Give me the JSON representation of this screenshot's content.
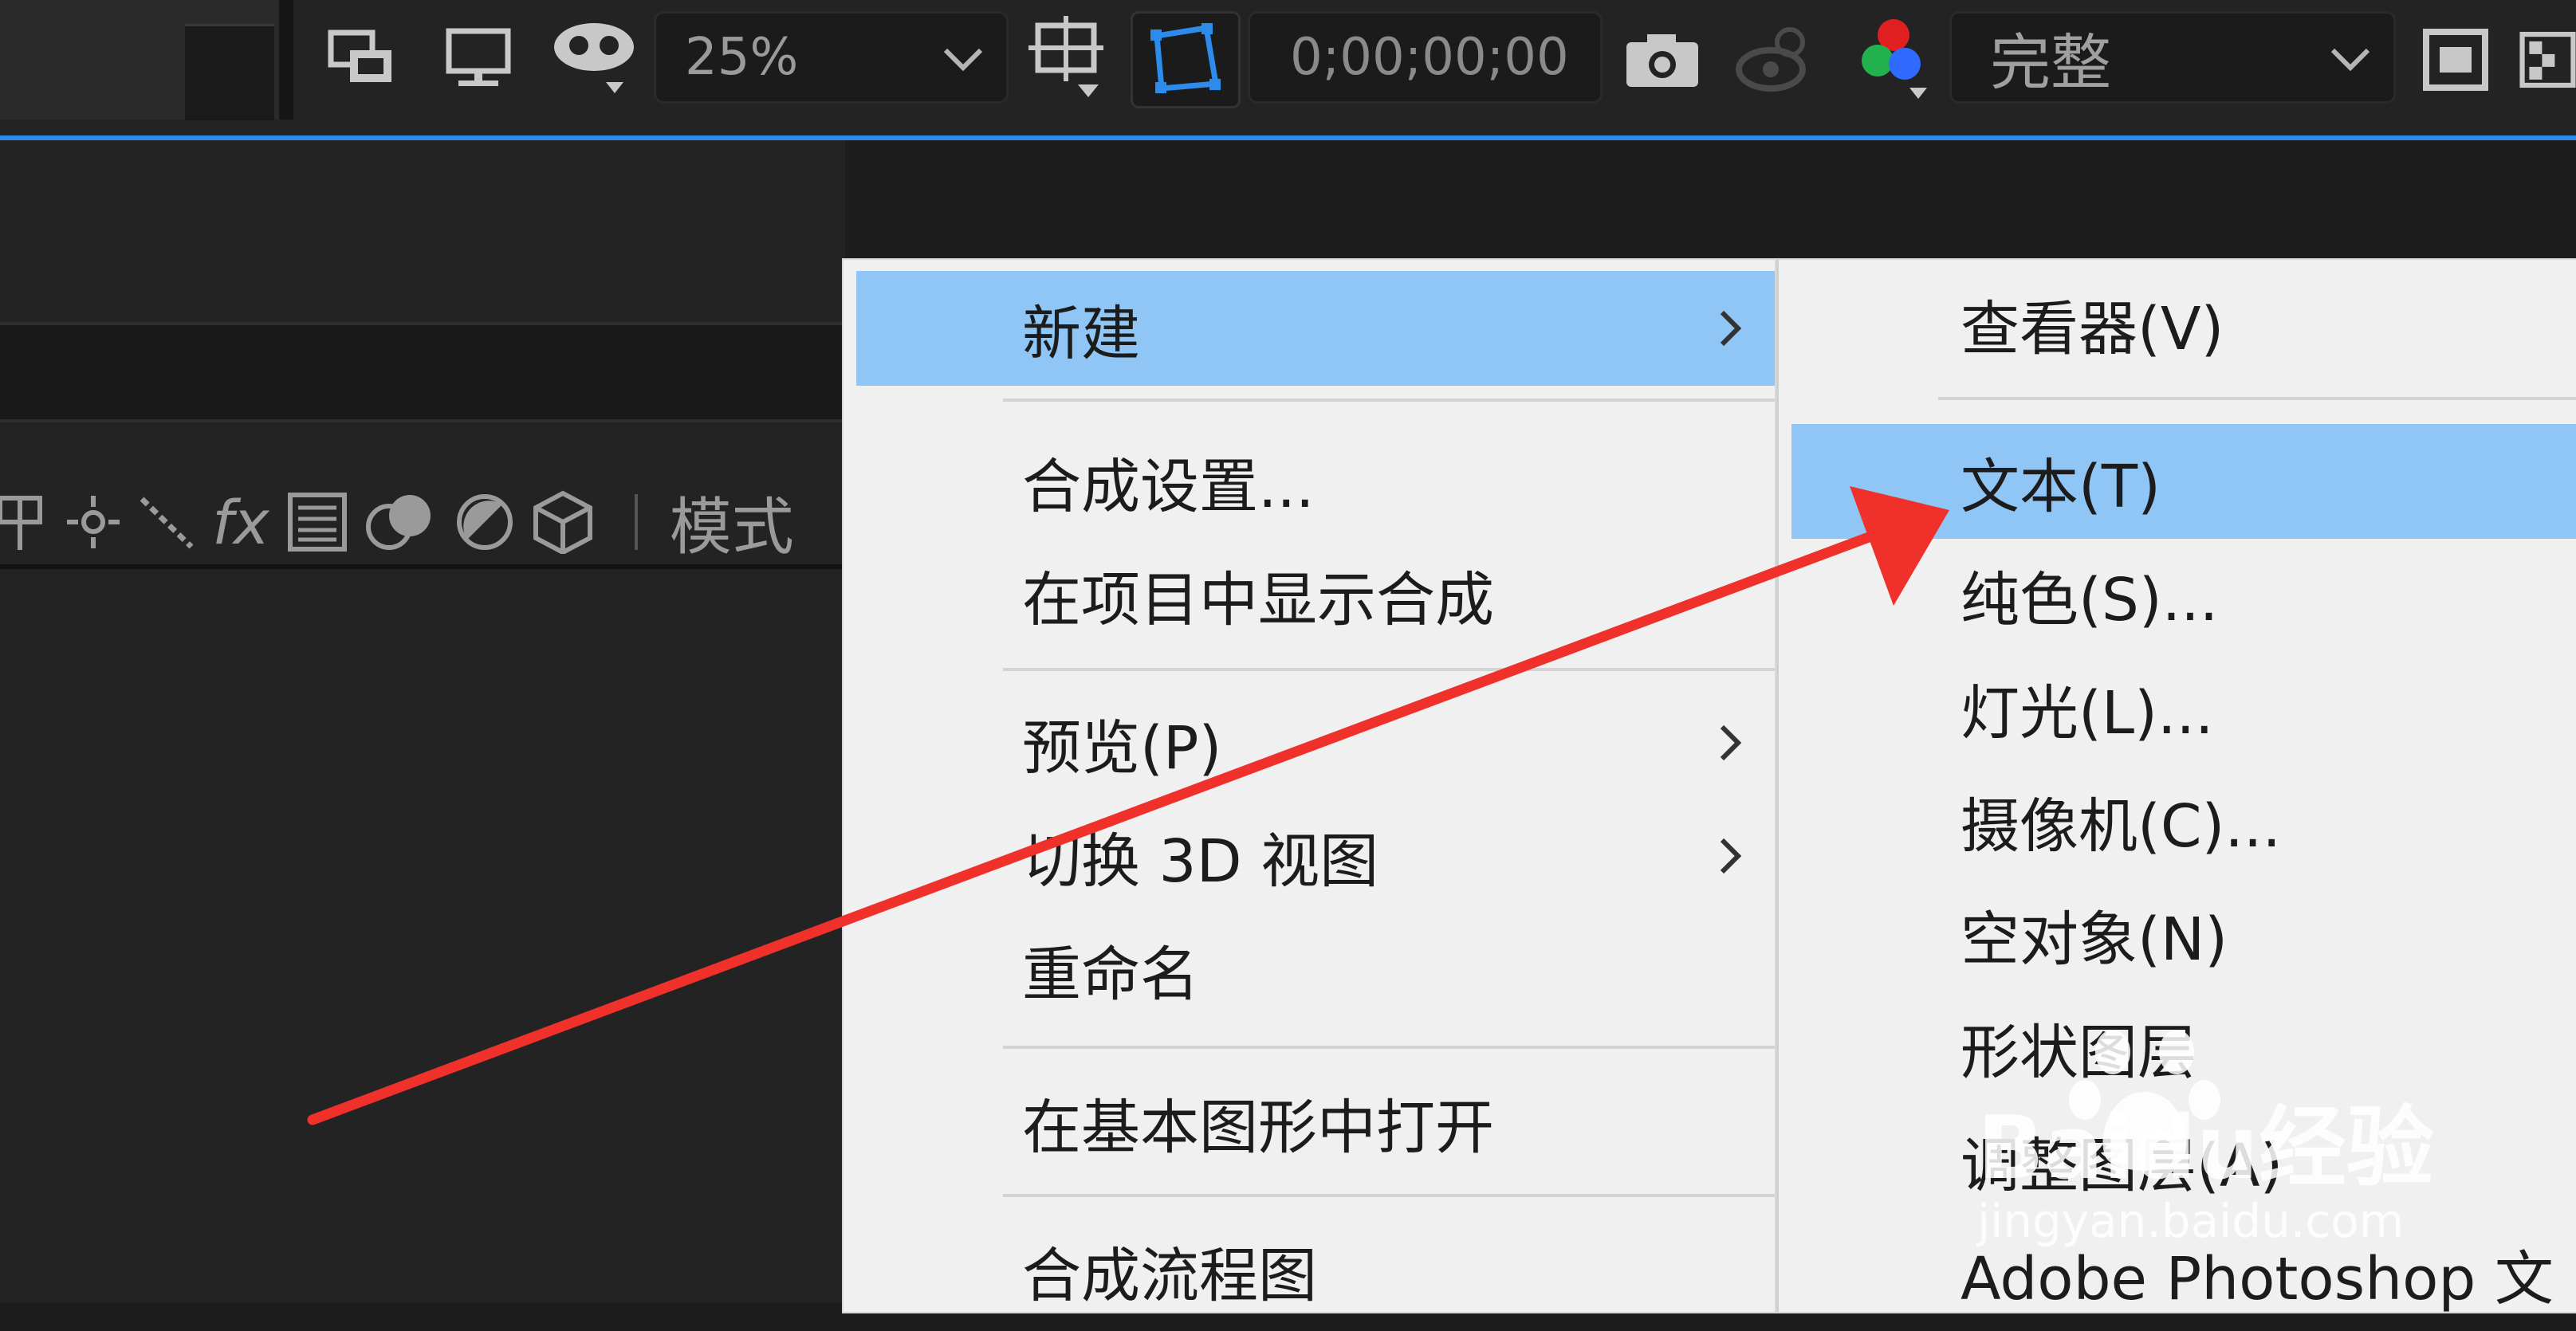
{
  "toolbar": {
    "zoom": {
      "value": "25%"
    },
    "timecode": "0;00;00;00",
    "resolution": {
      "value": "完整"
    }
  },
  "layer_panel": {
    "mode_label": "模式"
  },
  "context_menu": {
    "items": [
      {
        "label": "新建",
        "highlighted": true,
        "has_submenu": true
      },
      {
        "label": "合成设置..."
      },
      {
        "label": "在项目中显示合成"
      },
      {
        "label": "预览(P)",
        "has_submenu": true
      },
      {
        "label": "切换 3D 视图",
        "has_submenu": true
      },
      {
        "label": "重命名"
      },
      {
        "label": "在基本图形中打开"
      },
      {
        "label": "合成流程图"
      }
    ]
  },
  "submenu_new": {
    "items": [
      {
        "label": "查看器(V)"
      },
      {
        "label": "文本(T)",
        "highlighted": true
      },
      {
        "label": "纯色(S)..."
      },
      {
        "label": "灯光(L)..."
      },
      {
        "label": "摄像机(C)..."
      },
      {
        "label": "空对象(N)"
      },
      {
        "label": "形状图层"
      },
      {
        "label": "调整图层(A)"
      },
      {
        "label": "Adobe Photoshop 文"
      }
    ]
  },
  "watermark": {
    "brand": "Baidu经验",
    "url": "jingyan.baidu.com"
  },
  "colors": {
    "accent_blue": "#2d8ceb",
    "menu_highlight": "#8fc6f5",
    "annotation_red": "#f0302a"
  }
}
